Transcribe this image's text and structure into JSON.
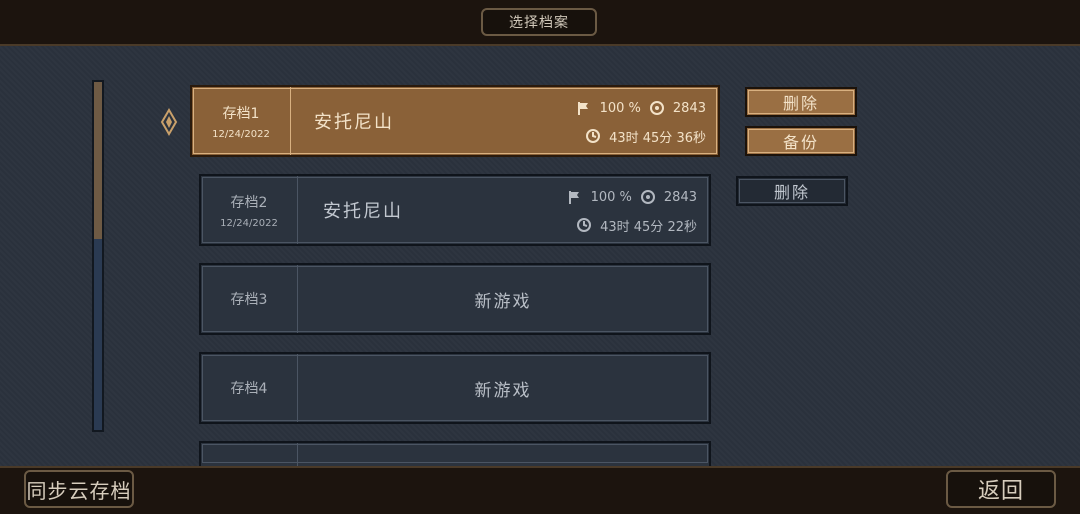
{
  "header": {
    "title": "选择档案"
  },
  "footer": {
    "sync_label": "同步云存档",
    "back_label": "返回"
  },
  "slots": [
    {
      "label": "存档1",
      "date": "12/24/2022",
      "place": "安托尼山",
      "progress": "100 %",
      "coins": "2843",
      "time": "43时 45分 36秒"
    },
    {
      "label": "存档2",
      "date": "12/24/2022",
      "place": "安托尼山",
      "progress": "100 %",
      "coins": "2843",
      "time": "43时 45分 22秒"
    },
    {
      "label": "存档3",
      "new_game": "新游戏"
    },
    {
      "label": "存档4",
      "new_game": "新游戏"
    }
  ],
  "actions": {
    "slot1_delete": "删除",
    "slot1_backup": "备份",
    "slot2_delete": "删除"
  },
  "icons": [
    "flag-icon",
    "coin-icon",
    "clock-icon",
    "selector-diamond-icon"
  ],
  "colors": {
    "active_slot": "#8a6138",
    "inactive_slot": "#2b333e",
    "bar": "#1c140e"
  },
  "scroll": {
    "position_fraction": 0.0,
    "visible_fraction": 0.45
  }
}
